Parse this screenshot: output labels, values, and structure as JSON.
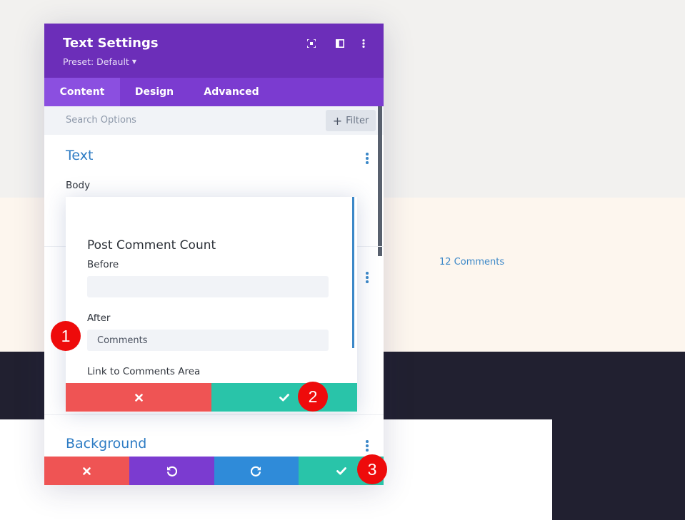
{
  "page": {
    "comments_link": "12 Comments"
  },
  "modal": {
    "title": "Text Settings",
    "preset": "Preset: Default",
    "header_icons": [
      "fullscreen-icon",
      "sidebar-layout-icon",
      "more-vertical-icon"
    ],
    "tabs": [
      {
        "label": "Content",
        "active": true
      },
      {
        "label": "Design",
        "active": false
      },
      {
        "label": "Advanced",
        "active": false
      }
    ],
    "search": {
      "placeholder": "Search Options",
      "value": ""
    },
    "filter_label": "Filter",
    "sections": {
      "text": {
        "title": "Text",
        "body_label": "Body"
      },
      "background": {
        "title": "Background"
      }
    },
    "bottom_actions": [
      {
        "name": "discard",
        "icon": "close-icon",
        "color": "#ef5454"
      },
      {
        "name": "undo",
        "icon": "undo-icon",
        "color": "#7b3bd0"
      },
      {
        "name": "redo",
        "icon": "redo-icon",
        "color": "#2f8bd9"
      },
      {
        "name": "save",
        "icon": "check-icon",
        "color": "#29c4a9"
      }
    ]
  },
  "popup": {
    "title": "Post Comment Count",
    "fields": {
      "before": {
        "label": "Before",
        "value": ""
      },
      "after": {
        "label": "After",
        "value": "Comments"
      },
      "link": {
        "label": "Link to Comments Area"
      }
    },
    "actions": [
      {
        "name": "cancel",
        "icon": "close-icon",
        "color": "#ef5454"
      },
      {
        "name": "confirm",
        "icon": "check-icon",
        "color": "#29c4a9"
      }
    ]
  },
  "markers": [
    "1",
    "2",
    "3"
  ],
  "colors": {
    "purple_header": "#6c2eb9",
    "purple_tabs": "#7b3bd0",
    "blue_accent": "#2e7cc4",
    "red": "#ef5454",
    "teal": "#29c4a9",
    "marker_red": "#ee0b0b"
  }
}
